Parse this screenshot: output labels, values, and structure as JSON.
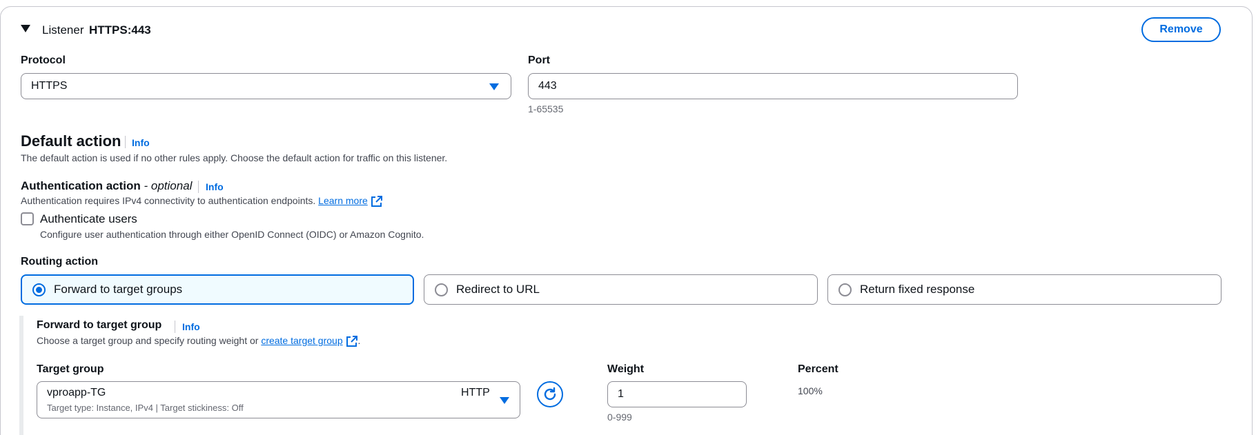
{
  "listener": {
    "label": "Listener",
    "value": "HTTPS:443",
    "remove_label": "Remove"
  },
  "protocol": {
    "label": "Protocol",
    "value": "HTTPS"
  },
  "port": {
    "label": "Port",
    "value": "443",
    "hint": "1-65535"
  },
  "default_action": {
    "title": "Default action",
    "info": "Info",
    "description": "The default action is used if no other rules apply. Choose the default action for traffic on this listener."
  },
  "auth": {
    "title": "Authentication action",
    "optional": "- optional",
    "info": "Info",
    "description": "Authentication requires IPv4 connectivity to authentication endpoints.",
    "learn_more": "Learn more",
    "checkbox_label": "Authenticate users",
    "checkbox_checked": false,
    "checkbox_desc": "Configure user authentication through either OpenID Connect (OIDC) or Amazon Cognito."
  },
  "routing": {
    "label": "Routing action",
    "options": [
      {
        "label": "Forward to target groups",
        "selected": true
      },
      {
        "label": "Redirect to URL",
        "selected": false
      },
      {
        "label": "Return fixed response",
        "selected": false
      }
    ]
  },
  "forward": {
    "title": "Forward to target group",
    "info": "Info",
    "description": "Choose a target group and specify routing weight or",
    "create_link": "create target group",
    "period": ".",
    "target_group_label": "Target group",
    "target_group_name": "vproapp-TG",
    "target_group_protocol": "HTTP",
    "target_group_details": "Target type: Instance, IPv4 | Target stickiness: Off",
    "weight_label": "Weight",
    "weight_value": "1",
    "weight_hint": "0-999",
    "percent_label": "Percent",
    "percent_value": "100%"
  },
  "colors": {
    "accent": "#006ce0",
    "selected_bg": "#f0fbff",
    "border": "#8c8c94"
  }
}
